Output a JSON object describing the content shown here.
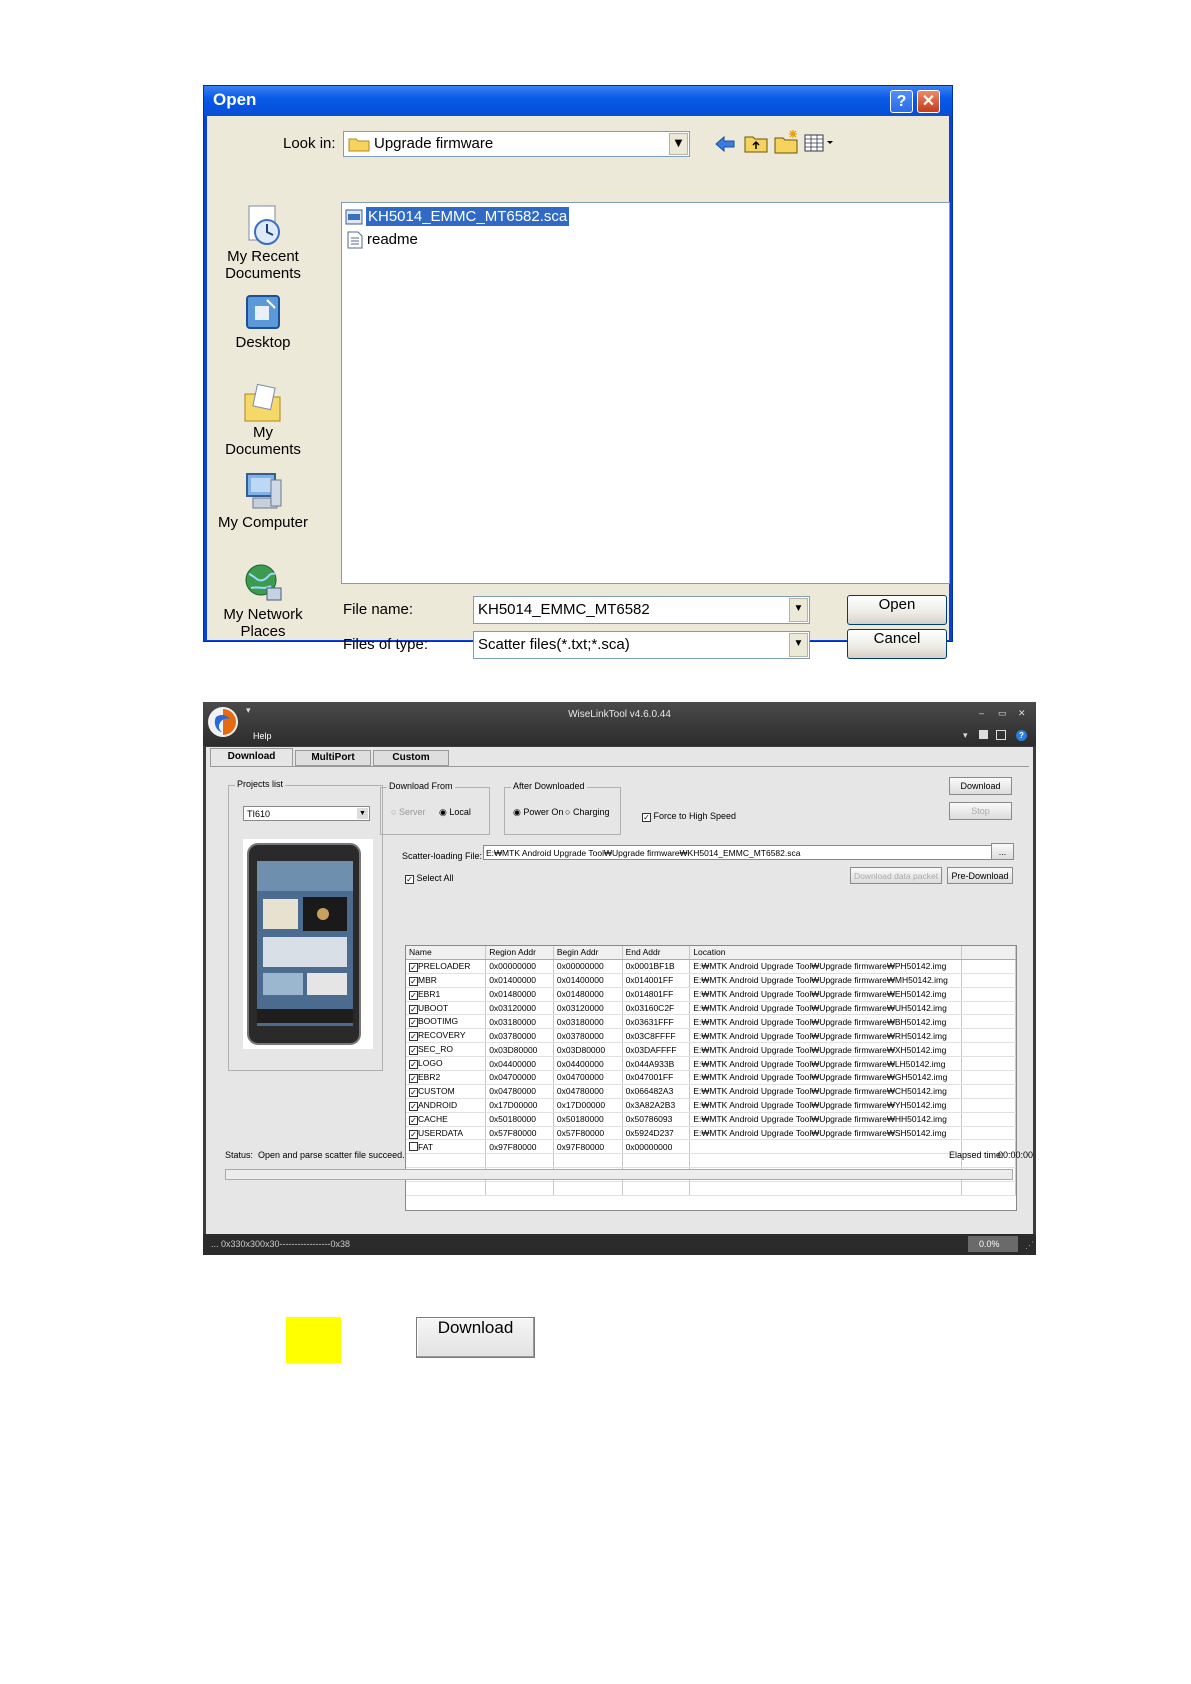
{
  "open_dialog": {
    "title": "Open",
    "help_glyph": "?",
    "close_glyph": "✕",
    "look_in_label": "Look in:",
    "look_in_value": "Upgrade firmware",
    "places": [
      "My Recent Documents",
      "Desktop",
      "My Documents",
      "My Computer",
      "My Network Places"
    ],
    "files": [
      {
        "name": "KH5014_EMMC_MT6582.sca",
        "icon": "scatter-file-icon",
        "selected": true
      },
      {
        "name": "readme",
        "icon": "text-file-icon",
        "selected": false
      }
    ],
    "file_name_label": "File name:",
    "file_name_value": "KH5014_EMMC_MT6582",
    "file_type_label": "Files of type:",
    "file_type_value": "Scatter files(*.txt;*.sca)",
    "open_button": "Open",
    "cancel_button": "Cancel",
    "toolbar_icons": [
      "back-arrow-icon",
      "up-folder-icon",
      "new-folder-icon",
      "view-menu-icon"
    ]
  },
  "wiselink": {
    "title": "WiseLinkTool v4.6.0.44",
    "menu_help": "Help",
    "tabs": [
      "Download",
      "MultiPort",
      "Custom"
    ],
    "projects_list_label": "Projects list",
    "project_value": "TI610",
    "download_from_label": "Download From",
    "server_option": "Server",
    "local_option": "Local",
    "after_downloaded_label": "After Downloaded",
    "power_on_option": "Power On",
    "charging_option": "Charging",
    "force_high_speed_label": "Force to High Speed",
    "download_button": "Download",
    "stop_button": "Stop",
    "scatter_label": "Scatter-loading File:",
    "scatter_value": "E:₩MTK Android Upgrade Tool₩Upgrade firmware₩KH5014_EMMC_MT6582.sca",
    "browse_button": "...",
    "select_all_label": "Select All",
    "download_data_packet_button": "Download data packet",
    "pre_download_button": "Pre-Download",
    "columns": [
      "Name",
      "Region Addr",
      "Begin Addr",
      "End Addr",
      "Location"
    ],
    "rows": [
      {
        "checked": true,
        "name": "PRELOADER",
        "region": "0x00000000",
        "begin": "0x00000000",
        "end": "0x0001BF1B",
        "location": "E:₩MTK Android Upgrade Tool₩Upgrade firmware₩PH50142.img"
      },
      {
        "checked": true,
        "name": "MBR",
        "region": "0x01400000",
        "begin": "0x01400000",
        "end": "0x014001FF",
        "location": "E:₩MTK Android Upgrade Tool₩Upgrade firmware₩MH50142.img"
      },
      {
        "checked": true,
        "name": "EBR1",
        "region": "0x01480000",
        "begin": "0x01480000",
        "end": "0x014801FF",
        "location": "E:₩MTK Android Upgrade Tool₩Upgrade firmware₩EH50142.img"
      },
      {
        "checked": true,
        "name": "UBOOT",
        "region": "0x03120000",
        "begin": "0x03120000",
        "end": "0x03160C2F",
        "location": "E:₩MTK Android Upgrade Tool₩Upgrade firmware₩UH50142.img"
      },
      {
        "checked": true,
        "name": "BOOTIMG",
        "region": "0x03180000",
        "begin": "0x03180000",
        "end": "0x03631FFF",
        "location": "E:₩MTK Android Upgrade Tool₩Upgrade firmware₩BH50142.img"
      },
      {
        "checked": true,
        "name": "RECOVERY",
        "region": "0x03780000",
        "begin": "0x03780000",
        "end": "0x03C8FFFF",
        "location": "E:₩MTK Android Upgrade Tool₩Upgrade firmware₩RH50142.img"
      },
      {
        "checked": true,
        "name": "SEC_RO",
        "region": "0x03D80000",
        "begin": "0x03D80000",
        "end": "0x03DAFFFF",
        "location": "E:₩MTK Android Upgrade Tool₩Upgrade firmware₩XH50142.img"
      },
      {
        "checked": true,
        "name": "LOGO",
        "region": "0x04400000",
        "begin": "0x04400000",
        "end": "0x044A933B",
        "location": "E:₩MTK Android Upgrade Tool₩Upgrade firmware₩LH50142.img"
      },
      {
        "checked": true,
        "name": "EBR2",
        "region": "0x04700000",
        "begin": "0x04700000",
        "end": "0x047001FF",
        "location": "E:₩MTK Android Upgrade Tool₩Upgrade firmware₩GH50142.img"
      },
      {
        "checked": true,
        "name": "CUSTOM",
        "region": "0x04780000",
        "begin": "0x04780000",
        "end": "0x066482A3",
        "location": "E:₩MTK Android Upgrade Tool₩Upgrade firmware₩CH50142.img"
      },
      {
        "checked": true,
        "name": "ANDROID",
        "region": "0x17D00000",
        "begin": "0x17D00000",
        "end": "0x3A82A2B3",
        "location": "E:₩MTK Android Upgrade Tool₩Upgrade firmware₩YH50142.img"
      },
      {
        "checked": true,
        "name": "CACHE",
        "region": "0x50180000",
        "begin": "0x50180000",
        "end": "0x50786093",
        "location": "E:₩MTK Android Upgrade Tool₩Upgrade firmware₩HH50142.img"
      },
      {
        "checked": true,
        "name": "USERDATA",
        "region": "0x57F80000",
        "begin": "0x57F80000",
        "end": "0x5924D237",
        "location": "E:₩MTK Android Upgrade Tool₩Upgrade firmware₩SH50142.img"
      },
      {
        "checked": false,
        "name": "FAT",
        "region": "0x97F80000",
        "begin": "0x97F80000",
        "end": "0x00000000",
        "location": ""
      }
    ],
    "status_label": "Status:",
    "status_value": "Open and parse scatter file succeed.",
    "elapsed_label": "Elapsed time:",
    "elapsed_value": "00:00:00",
    "bottom_bar_text": "... 0x330x300x30-----------------0x38",
    "bottom_percent": "0.0%"
  },
  "legend": {
    "swatch_color": "#ffff00",
    "download_button": "Download"
  }
}
